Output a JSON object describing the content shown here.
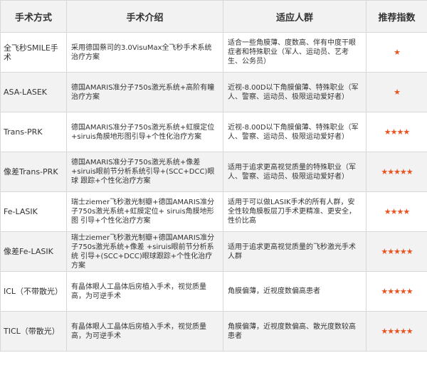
{
  "table": {
    "headers": [
      "手术方式",
      "手术介绍",
      "适应人群",
      "推荐指数"
    ],
    "rows": [
      {
        "method": "全飞秒SMILE手术",
        "intro": "采用德国蔡司的3.0VisuMax全飞秒手术系统治疗方案",
        "suitable": "适合一些角膜薄、度数高、伴有中度干眼症者和特殊职业（军人、运动员、艺考生、公务员）",
        "rating": "★"
      },
      {
        "method": "ASA-LASEK",
        "intro": "德国AMARIS准分子750s激光系统+高阶有瞳治疗方案",
        "suitable": "近视-8.00D以下角膜偏薄、特殊职业（军人、警察、运动员、极限运动爱好者）",
        "rating": "★"
      },
      {
        "method": "Trans-PRK",
        "intro": "德国AMARIS准分子750s激光系统+虹膜定位+siruis角膜地形图引导+个性化治疗方案",
        "suitable": "近视-8.00D以下角膜偏薄、特殊职业（军人、警察、运动员、极限运动爱好者）",
        "rating": "★★★★"
      },
      {
        "method": "像差Trans-PRK",
        "intro": "德国AMARIS准分子750s激光系统+像差+siruis眼前节分析系统引导+(SCC+DCC)眼球 跟踪+个性化治疗方案",
        "suitable": "适用于追求更高视觉质量的特殊职业（军人、警察、运动员、极限运动爱好者）",
        "rating": "★★★★★"
      },
      {
        "method": "Fe-LASIK",
        "intro": "瑞士ziemer飞秒激光制瓣+德国AMARIS准分子750s激光系统+虹膜定位+ siruis角膜地形图 引导+个性化治疗方案",
        "suitable": "适用于可以做LASIK手术的所有人群，安全性较角膜板层刀手术更精准、更安全，性价比高",
        "rating": "★★★★"
      },
      {
        "method": "像差Fe-LASIK",
        "intro": "瑞士ziemer飞秒激光制瓣+德国AMARIS准分子750s激光系统+像差 +siruis眼前节分析系统 引导+(SCC+DCC)眼球跟踪+个性化治疗方案",
        "suitable": "适用于追求更高视觉质量的飞秒激光手术人群",
        "rating": "★★★★★"
      },
      {
        "method": "ICL（不带散光）",
        "intro": "有晶体眼人工晶体后房植入手术，视觉质量高，为可逆手术",
        "suitable": "角膜偏薄，近视度数偏高患者",
        "rating": "★★★★★"
      },
      {
        "method": "TICL（带散光）",
        "intro": "有晶体眼人工晶体后房植入手术，视觉质量高，为可逆手术",
        "suitable": "角膜偏薄，近视度数偏高、散光度数较高患者",
        "rating": "★★★★★"
      }
    ]
  },
  "colors": {
    "header_bg": "#f2f2f2",
    "alt_row_bg": "#f2f2f2",
    "border": "#d7d7d7",
    "star": "#e8541f",
    "text": "#333333"
  },
  "icons": {
    "rating_star": "star-icon"
  }
}
